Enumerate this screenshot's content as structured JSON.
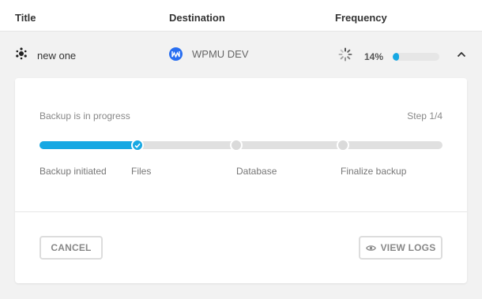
{
  "table": {
    "headers": {
      "title": "Title",
      "destination": "Destination",
      "frequency": "Frequency"
    }
  },
  "row": {
    "name": "new one",
    "destination": "WPMU DEV",
    "progress_text": "14%",
    "progress": 0.14,
    "icon": "hub-icon",
    "destination_icon": "wpmu-dev-icon"
  },
  "panel": {
    "status": "Backup is in progress",
    "step_counter": "Step 1/4",
    "progress": 0.24,
    "steps": [
      {
        "label": "Backup initiated",
        "state": "done"
      },
      {
        "label": "Files",
        "state": "done"
      },
      {
        "label": "Database",
        "state": "pending"
      },
      {
        "label": "Finalize backup",
        "state": "pending"
      }
    ],
    "cancel_label": "CANCEL",
    "view_logs_label": "VIEW LOGS"
  },
  "colors": {
    "accent": "#17a8e3",
    "wpmu_blue": "#286ef1",
    "track": "#e0e0e0"
  }
}
